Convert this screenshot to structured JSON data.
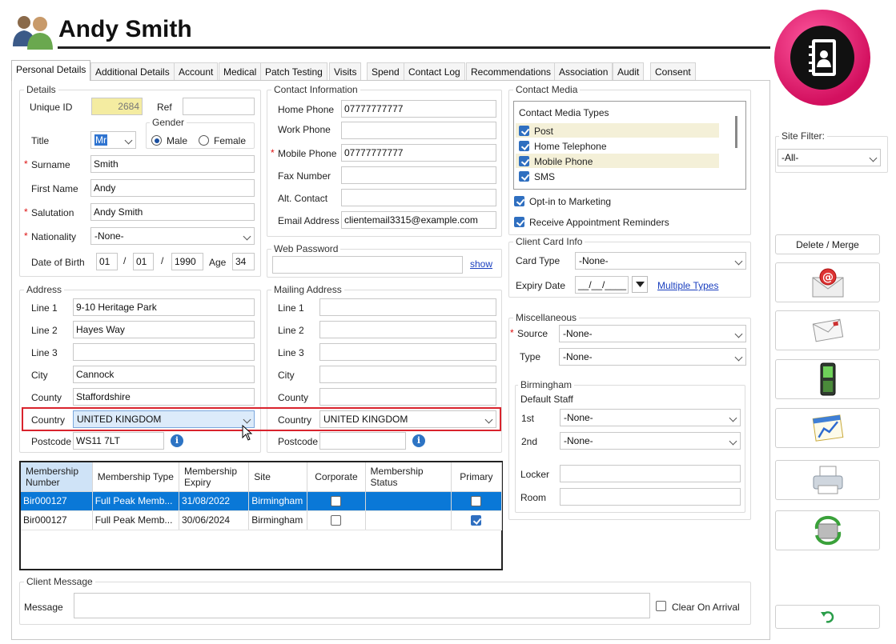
{
  "header": {
    "client_name": "Andy Smith"
  },
  "tabs": [
    "Personal Details",
    "Additional Details",
    "Account",
    "Medical",
    "Patch Testing",
    "Visits",
    "Spend",
    "Contact Log",
    "Recommendations",
    "Association",
    "Audit",
    "Consent"
  ],
  "details": {
    "title": "Details",
    "unique_id_label": "Unique ID",
    "unique_id": "2684",
    "ref_label": "Ref",
    "ref": "",
    "title_label": "Title",
    "title_value": "Mr",
    "gender_label": "Gender",
    "male_label": "Male",
    "female_label": "Female",
    "surname_label": "Surname",
    "surname": "Smith",
    "first_name_label": "First Name",
    "first_name": "Andy",
    "salutation_label": "Salutation",
    "salutation": "Andy Smith",
    "nationality_label": "Nationality",
    "nationality": "-None-",
    "dob_label": "Date of Birth",
    "dob_day": "01",
    "dob_month": "01",
    "dob_year": "1990",
    "sep": "/",
    "age_label": "Age",
    "age": "34"
  },
  "contact": {
    "title": "Contact Information",
    "home_phone_label": "Home Phone",
    "home_phone": "07777777777",
    "work_phone_label": "Work Phone",
    "work_phone": "",
    "mobile_phone_label": "Mobile Phone",
    "mobile_phone": "07777777777",
    "fax_label": "Fax Number",
    "fax": "",
    "alt_label": "Alt. Contact",
    "alt": "",
    "email_label": "Email Address",
    "email": "clientemail3315@example.com"
  },
  "web_password": {
    "title": "Web Password",
    "show_link": "show"
  },
  "address": {
    "title": "Address",
    "line1_label": "Line 1",
    "line1": "9-10 Heritage Park",
    "line2_label": "Line 2",
    "line2": "Hayes Way",
    "line3_label": "Line 3",
    "line3": "",
    "city_label": "City",
    "city": "Cannock",
    "county_label": "County",
    "county": "Staffordshire",
    "country_label": "Country",
    "country": "UNITED KINGDOM",
    "postcode_label": "Postcode",
    "postcode": "WS11 7LT"
  },
  "mailing": {
    "title": "Mailing Address",
    "line1_label": "Line 1",
    "line2_label": "Line 2",
    "line3_label": "Line 3",
    "city_label": "City",
    "county_label": "County",
    "country_label": "Country",
    "country": "UNITED KINGDOM",
    "postcode_label": "Postcode"
  },
  "contact_media": {
    "title": "Contact Media",
    "list_header": "Contact Media Types",
    "items": [
      "Post",
      "Home Telephone",
      "Mobile Phone",
      "SMS"
    ],
    "opt_in_label": "Opt-in to Marketing",
    "reminders_label": "Receive Appointment Reminders"
  },
  "client_card": {
    "title": "Client Card Info",
    "card_type_label": "Card Type",
    "card_type": "-None-",
    "expiry_label": "Expiry Date",
    "expiry": "__/__/____",
    "multiple_types_link": "Multiple Types"
  },
  "misc": {
    "title": "Miscellaneous",
    "source_label": "Source",
    "source": "-None-",
    "type_label": "Type",
    "type": "-None-",
    "site_group_title": "Birmingham",
    "default_staff_label": "Default Staff",
    "first_label": "1st",
    "first": "-None-",
    "second_label": "2nd",
    "second": "-None-",
    "locker_label": "Locker",
    "room_label": "Room"
  },
  "memberships": {
    "headers": [
      "Membership Number",
      "Membership Type",
      "Membership Expiry",
      "Site",
      "Corporate",
      "Membership Status",
      "Primary"
    ],
    "rows": [
      {
        "number": "Bir000127",
        "type": "Full Peak Memb...",
        "expiry": "31/08/2022",
        "site": "Birmingham",
        "corporate": false,
        "status": "",
        "primary": false
      },
      {
        "number": "Bir000127",
        "type": "Full Peak Memb...",
        "expiry": "30/06/2024",
        "site": "Birmingham",
        "corporate": false,
        "status": "",
        "primary": true
      }
    ]
  },
  "client_message": {
    "title": "Client Message",
    "message_label": "Message",
    "clear_label": "Clear On Arrival"
  },
  "sidebar": {
    "site_filter_label": "Site Filter:",
    "site_filter": "-All-",
    "delete_merge": "Delete / Merge"
  },
  "colors": {
    "accent_pink": "#e0156e",
    "selection_blue": "#0a78d7",
    "highlight_red": "#d9232d"
  }
}
